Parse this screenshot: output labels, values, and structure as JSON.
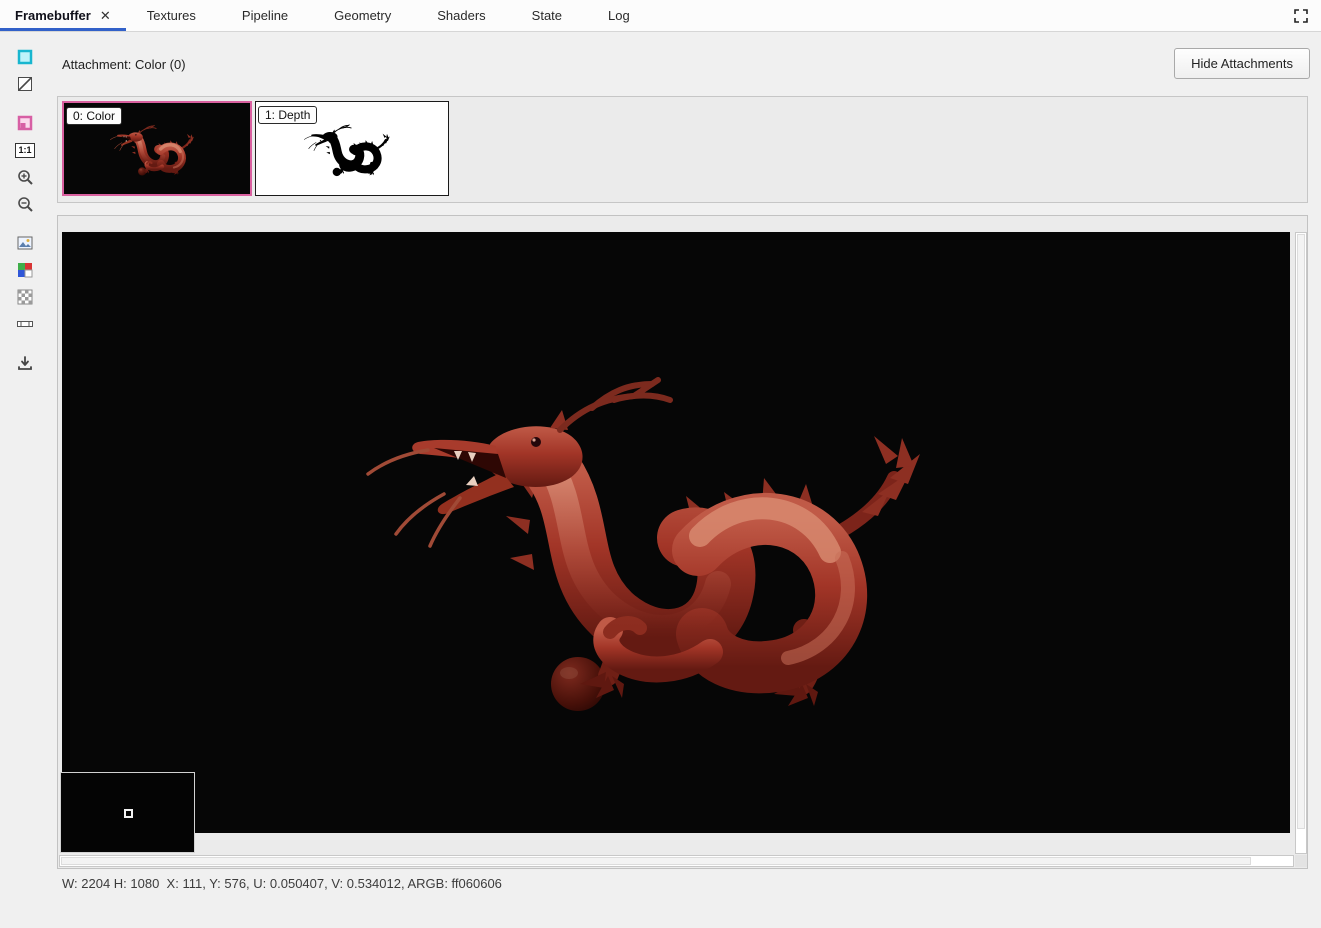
{
  "tabs": [
    {
      "label": "Framebuffer",
      "active": true,
      "closable": true
    },
    {
      "label": "Textures",
      "active": false
    },
    {
      "label": "Pipeline",
      "active": false
    },
    {
      "label": "Geometry",
      "active": false
    },
    {
      "label": "Shaders",
      "active": false
    },
    {
      "label": "State",
      "active": false
    },
    {
      "label": "Log",
      "active": false
    }
  ],
  "icons": {
    "close": "✕",
    "fullscreen": "expand-corners",
    "toolbar": [
      "background-color",
      "disable-alpha",
      "overlay-color",
      "actual-size",
      "zoom-in",
      "zoom-out",
      "fit-image",
      "rgba-channels",
      "checkerboard-background",
      "range-bar",
      "save"
    ]
  },
  "toolbar": {
    "actual_size_label": "1:1"
  },
  "header": {
    "attachment_label": "Attachment: Color (0)",
    "hide_attachments_button": "Hide Attachments"
  },
  "attachments": {
    "items": [
      {
        "label": "0: Color",
        "selected": true
      },
      {
        "label": "1: Depth",
        "selected": false
      }
    ]
  },
  "preview": {
    "canvas_image": "stanford-dragon-render"
  },
  "status_bar": {
    "text": "W: 2204 H: 1080  X: 111, Y: 576, U: 0.050407, V: 0.534012, ARGB: ff060606"
  },
  "colors": {
    "accent_blue": "#3261c9",
    "selection_pink": "#d9609f",
    "canvas_black": "#060606",
    "dragon_red": "#a23527"
  }
}
